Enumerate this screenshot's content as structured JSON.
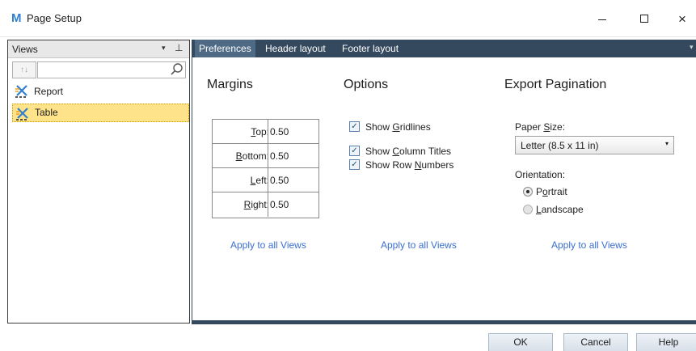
{
  "window": {
    "logo": "M",
    "title": "Page Setup",
    "controls": {
      "minimize": "minimize",
      "maximize": "maximize",
      "close": "×"
    }
  },
  "views_panel": {
    "title": "Views",
    "dropdown_glyph": "▾",
    "pin_glyph": "⊥",
    "sort_glyph": "↑↓",
    "search_value": "",
    "items": [
      {
        "label": "Report",
        "selected": false
      },
      {
        "label": "Table",
        "selected": true
      }
    ]
  },
  "tabs": [
    {
      "label": "Preferences",
      "active": true
    },
    {
      "label": "Header layout",
      "active": false
    },
    {
      "label": "Footer layout",
      "active": false
    }
  ],
  "tabs_overflow_glyph": "▾",
  "margins": {
    "title": "Margins",
    "rows": [
      {
        "label_accel": "T",
        "label_rest": "op:",
        "value": "0.50"
      },
      {
        "label_accel": "B",
        "label_rest": "ottom:",
        "value": "0.50"
      },
      {
        "label_accel": "L",
        "label_rest": "eft:",
        "value": "0.50"
      },
      {
        "label_accel": "R",
        "label_rest": "ight:",
        "value": "0.50"
      }
    ],
    "apply": "Apply to all Views"
  },
  "options": {
    "title": "Options",
    "checkboxes": [
      {
        "pre": "Show ",
        "accel": "G",
        "post": "ridlines",
        "checked": true
      },
      {
        "pre": "Show ",
        "accel": "C",
        "post": "olumn Titles",
        "checked": true
      },
      {
        "pre": "Show Row ",
        "accel": "N",
        "post": "umbers",
        "checked": true
      }
    ],
    "check_glyph": "✓",
    "apply": "Apply to all Views"
  },
  "export": {
    "title": "Export Pagination",
    "paper_size_label_pre": "Paper ",
    "paper_size_label_accel": "S",
    "paper_size_label_post": "ize:",
    "paper_size_value": "Letter (8.5 x 11 in)",
    "select_arrow": "▾",
    "orientation_label": "Orientation:",
    "portrait_pre": "P",
    "portrait_accel": "o",
    "portrait_post": "rtrait",
    "landscape_pre": "",
    "landscape_accel": "L",
    "landscape_post": "andscape",
    "orientation_selected": "Portrait",
    "apply": "Apply to all Views"
  },
  "footer": {
    "ok": "OK",
    "cancel": "Cancel",
    "help": "Help"
  },
  "colors": {
    "tab_bar": "#35495e",
    "active_tab": "#4e6a85",
    "selected_view": "#ffe38a",
    "link": "#3b6fd0",
    "logo": "#2f7fd1"
  }
}
